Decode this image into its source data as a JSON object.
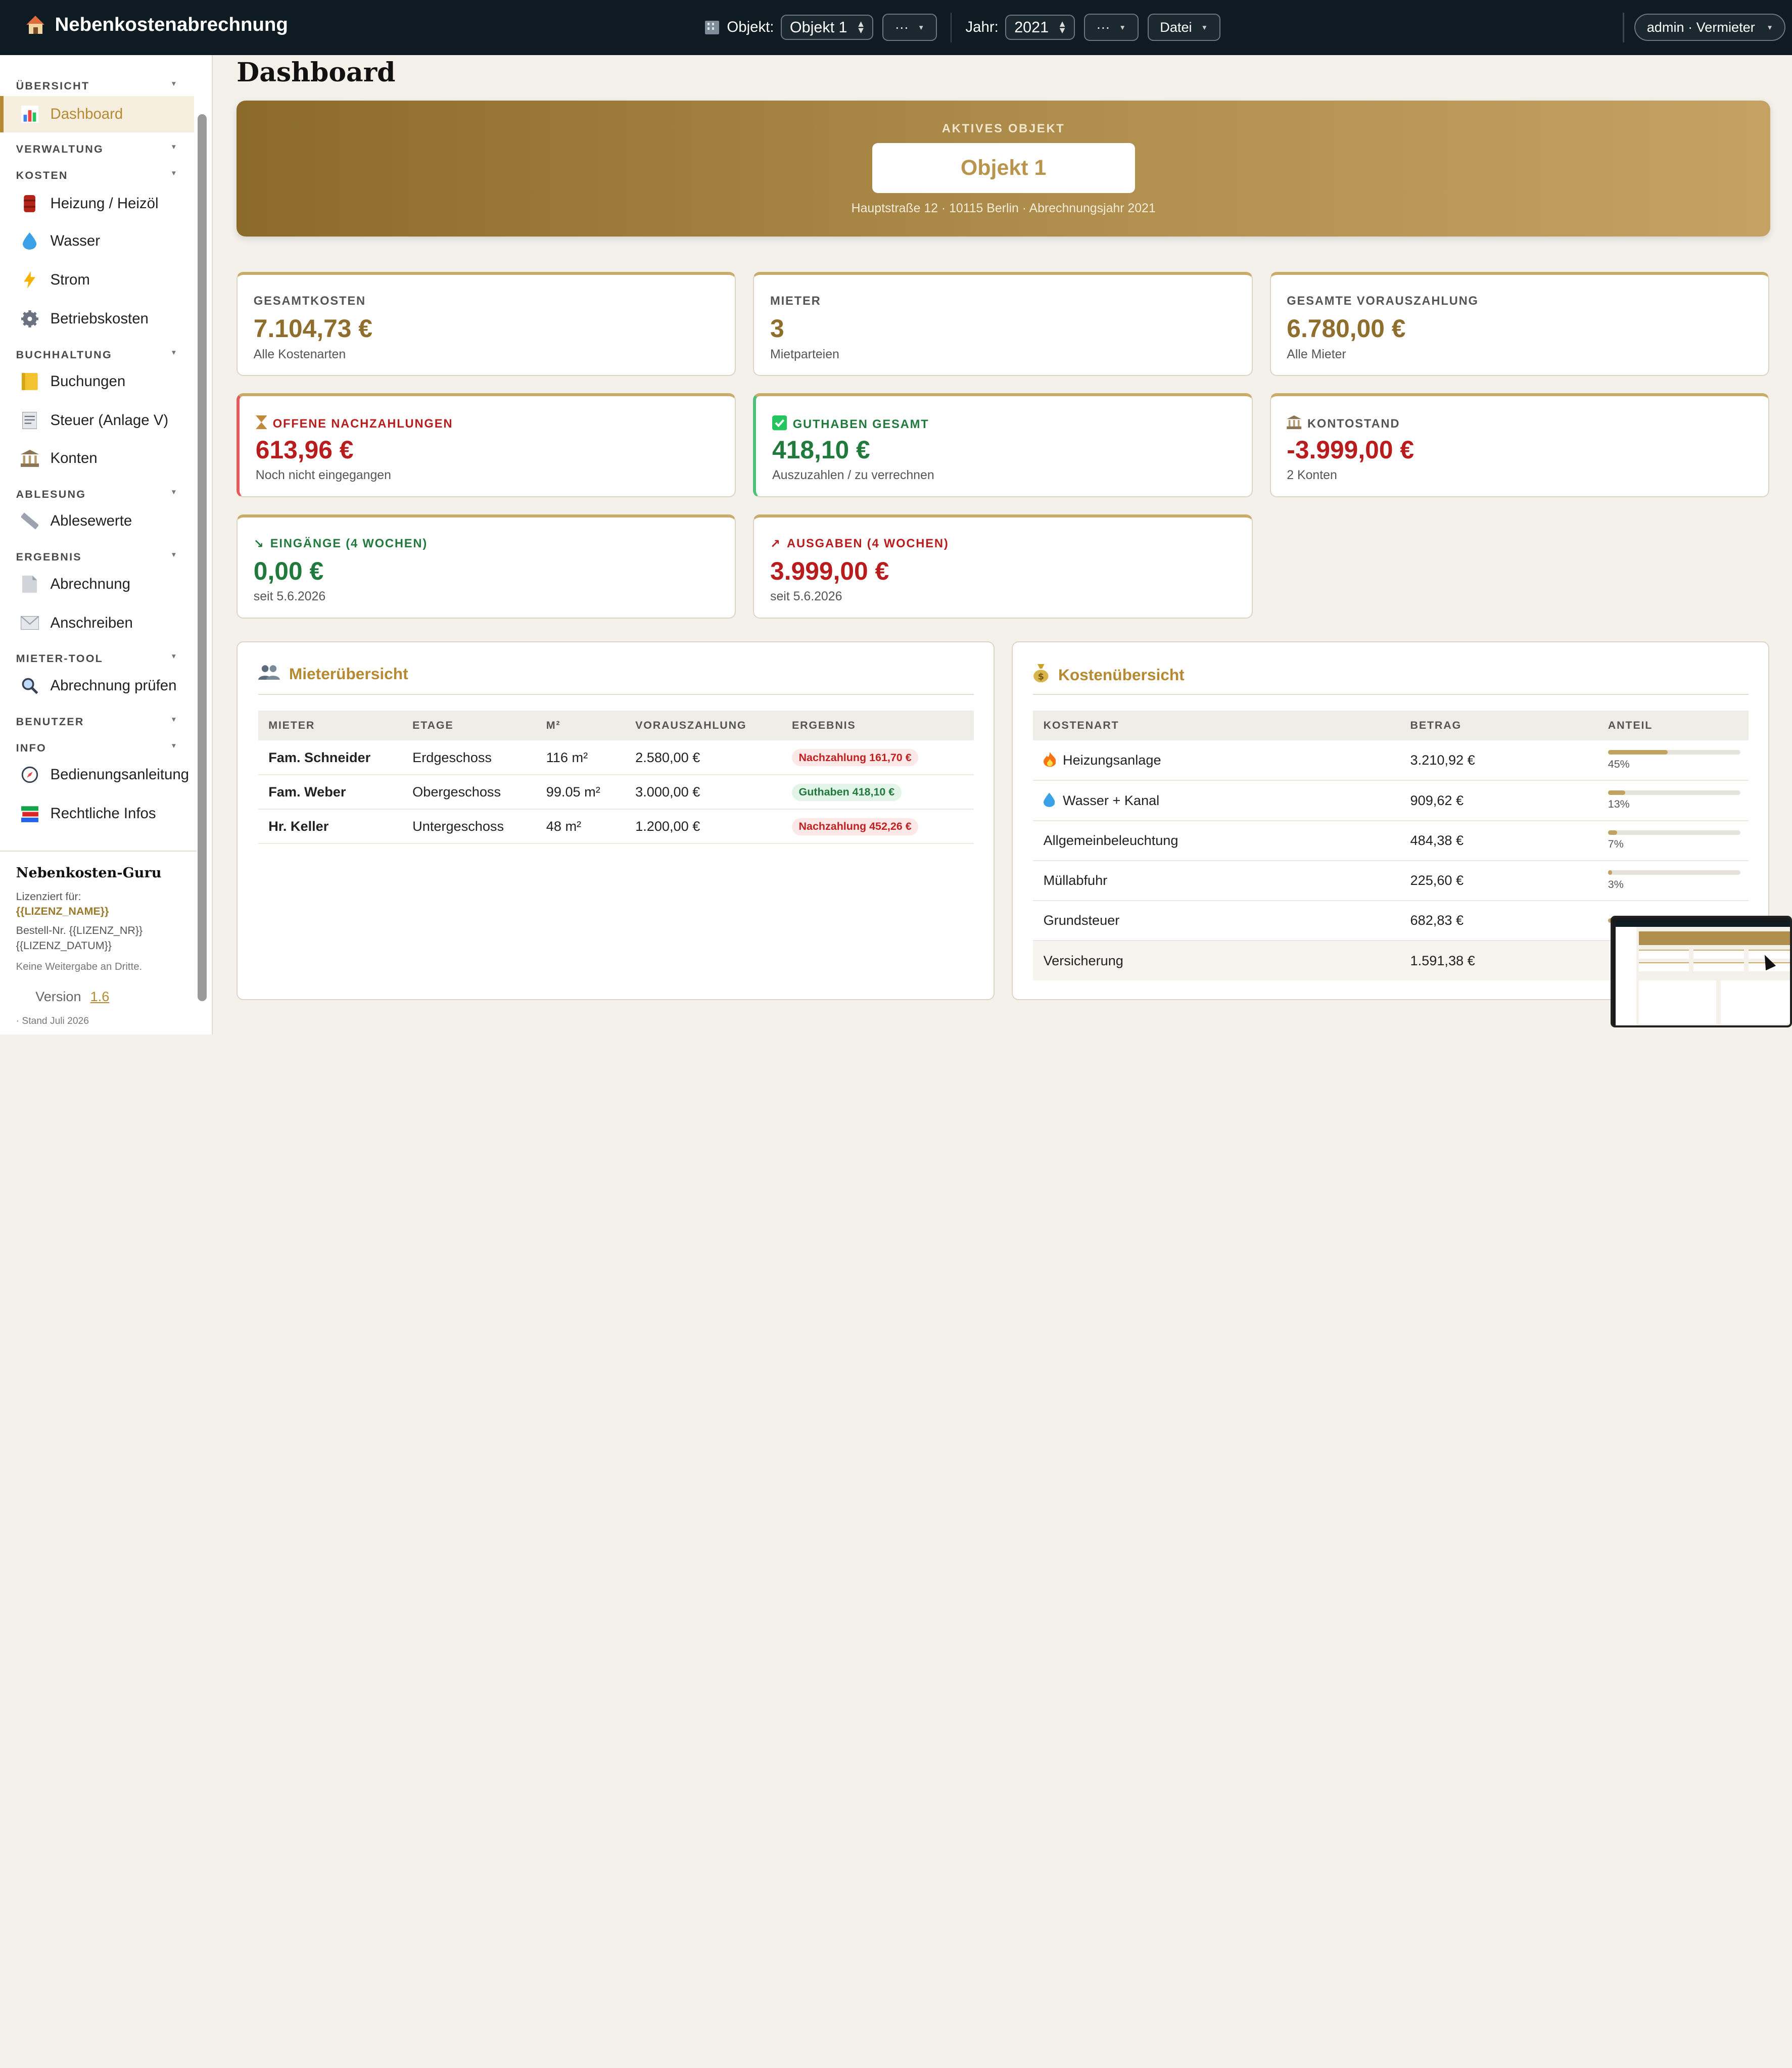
{
  "app": {
    "title": "Nebenkostenabrechnung"
  },
  "topbar": {
    "objekt_label": "Objekt:",
    "objekt_value": "Objekt 1",
    "objekt_more": "···",
    "jahr_label": "Jahr:",
    "jahr_value": "2021",
    "jahr_more": "···",
    "datei_label": "Datei",
    "user_label": "admin · Vermieter"
  },
  "sidebar": {
    "sections": {
      "uebersicht": "ÜBERSICHT",
      "verwaltung": "VERWALTUNG",
      "kosten": "KOSTEN",
      "buchhaltung": "BUCHHALTUNG",
      "ablesung": "ABLESUNG",
      "ergebnis": "ERGEBNIS",
      "mieter_tool": "MIETER-TOOL",
      "benutzer": "BENUTZER",
      "info": "INFO"
    },
    "items": {
      "dashboard": "Dashboard",
      "heizung": "Heizung / Heizöl",
      "wasser": "Wasser",
      "strom": "Strom",
      "betriebskosten": "Betriebskosten",
      "buchungen": "Buchungen",
      "steuer": "Steuer (Anlage V)",
      "konten": "Konten",
      "ablesewerte": "Ablesewerte",
      "abrechnung": "Abrechnung",
      "anschreiben": "Anschreiben",
      "abrechnung_pruefen": "Abrechnung prüfen",
      "bedienungsanleitung": "Bedienungsanleitung",
      "rechtliche_infos": "Rechtliche Infos"
    },
    "license": {
      "title": "Nebenkosten-Guru",
      "licensed_for": "Lizenziert für:",
      "name": "{{LIZENZ_NAME}}",
      "order": "Bestell-Nr. {{LIZENZ_NR}}",
      "date": "{{LIZENZ_DATUM}}",
      "note": "Keine Weitergabe an Dritte.",
      "version_label": "Version",
      "version_value": "1.6",
      "stand": "· Stand Juli 2026"
    }
  },
  "main": {
    "page_title": "Dashboard",
    "hero": {
      "label": "AKTIVES OBJEKT",
      "object": "Objekt 1",
      "subtitle": "Hauptstraße 12 · 10115 Berlin · Abrechnungsjahr 2021"
    },
    "cards": {
      "gesamtkosten": {
        "label": "GESAMTKOSTEN",
        "value": "7.104,73 €",
        "sub": "Alle Kostenarten"
      },
      "mieter": {
        "label": "MIETER",
        "value": "3",
        "sub": "Mietparteien"
      },
      "vorauszahlung": {
        "label": "GESAMTE VORAUSZAHLUNG",
        "value": "6.780,00 €",
        "sub": "Alle Mieter"
      },
      "nachzahlungen": {
        "label": "OFFENE NACHZAHLUNGEN",
        "value": "613,96 €",
        "sub": "Noch nicht eingegangen"
      },
      "guthaben": {
        "label": "GUTHABEN GESAMT",
        "value": "418,10 €",
        "sub": "Auszuzahlen / zu verrechnen"
      },
      "kontostand": {
        "label": "KONTOSTAND",
        "value": "-3.999,00 €",
        "sub": "2 Konten"
      },
      "eingaenge": {
        "label": "EINGÄNGE (4 WOCHEN)",
        "value": "0,00 €",
        "sub": "seit 5.6.2026"
      },
      "ausgaben": {
        "label": "AUSGABEN (4 WOCHEN)",
        "value": "3.999,00 €",
        "sub": "seit 5.6.2026"
      }
    },
    "mieter_panel": {
      "title": "Mieterübersicht",
      "headers": [
        "MIETER",
        "ETAGE",
        "M²",
        "VORAUSZAHLUNG",
        "ERGEBNIS"
      ],
      "rows": [
        {
          "name": "Fam. Schneider",
          "etage": "Erdgeschoss",
          "qm": "116 m²",
          "vz": "2.580,00 €",
          "ergebnis": "Nachzahlung 161,70 €",
          "status": "red"
        },
        {
          "name": "Fam. Weber",
          "etage": "Obergeschoss",
          "qm": "99.05 m²",
          "vz": "3.000,00 €",
          "ergebnis": "Guthaben 418,10 €",
          "status": "green"
        },
        {
          "name": "Hr. Keller",
          "etage": "Untergeschoss",
          "qm": "48 m²",
          "vz": "1.200,00 €",
          "ergebnis": "Nachzahlung 452,26 €",
          "status": "red"
        }
      ]
    },
    "kosten_panel": {
      "title": "Kostenübersicht",
      "headers": [
        "KOSTENART",
        "BETRAG",
        "ANTEIL"
      ],
      "rows": [
        {
          "icon": "fire-icon",
          "name": "Heizungsanlage",
          "betrag": "3.210,92 €",
          "anteil": 45,
          "anteil_label": "45%"
        },
        {
          "icon": "droplet-icon",
          "name": "Wasser + Kanal",
          "betrag": "909,62 €",
          "anteil": 13,
          "anteil_label": "13%"
        },
        {
          "icon": "",
          "name": "Allgemeinbeleuchtung",
          "betrag": "484,38 €",
          "anteil": 7,
          "anteil_label": "7%"
        },
        {
          "icon": "",
          "name": "Müllabfuhr",
          "betrag": "225,60 €",
          "anteil": 3,
          "anteil_label": "3%"
        },
        {
          "icon": "",
          "name": "Grundsteuer",
          "betrag": "682,83 €",
          "anteil": 10,
          "anteil_label": ""
        },
        {
          "icon": "",
          "name": "Versicherung",
          "betrag": "1.591,38 €",
          "anteil": 22,
          "anteil_label": ""
        }
      ]
    }
  },
  "colors": {
    "accent": "#b58a32",
    "topbar": "#0f1b22",
    "negative": "#b91c1c",
    "positive": "#1f7a3c"
  }
}
